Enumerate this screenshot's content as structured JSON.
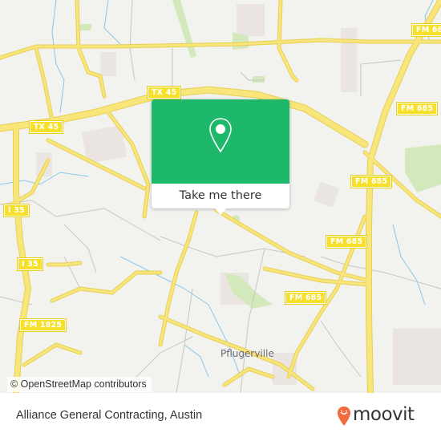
{
  "map": {
    "place_label": "Pflugerville",
    "road_shields": [
      {
        "id": "tx45-east",
        "label": "TX 45"
      },
      {
        "id": "tx45-west",
        "label": "TX 45"
      },
      {
        "id": "fm685-ne",
        "label": "FM 685"
      },
      {
        "id": "fm685-e1",
        "label": "FM 685"
      },
      {
        "id": "fm685-e2",
        "label": "FM 685"
      },
      {
        "id": "fm685-mid",
        "label": "FM 685"
      },
      {
        "id": "fm685-s",
        "label": "FM 685"
      },
      {
        "id": "i35-n",
        "label": "I 35"
      },
      {
        "id": "i35-s",
        "label": "I 35"
      },
      {
        "id": "fm1825",
        "label": "FM 1825"
      }
    ],
    "attribution": "© OpenStreetMap contributors",
    "colors": {
      "background": "#f2f2ee",
      "road": "#f6e263",
      "shield": "#f6e02c",
      "water": "#8cc8e8",
      "park": "#cfe8b0",
      "landuse": "#ebe5e2"
    }
  },
  "popup": {
    "icon": "map-pin-icon",
    "button_label": "Take me there",
    "color": "#1eb86a"
  },
  "footer": {
    "title": "Alliance General Contracting, Austin",
    "brand": "moovit",
    "brand_color": "#f26a3d"
  }
}
